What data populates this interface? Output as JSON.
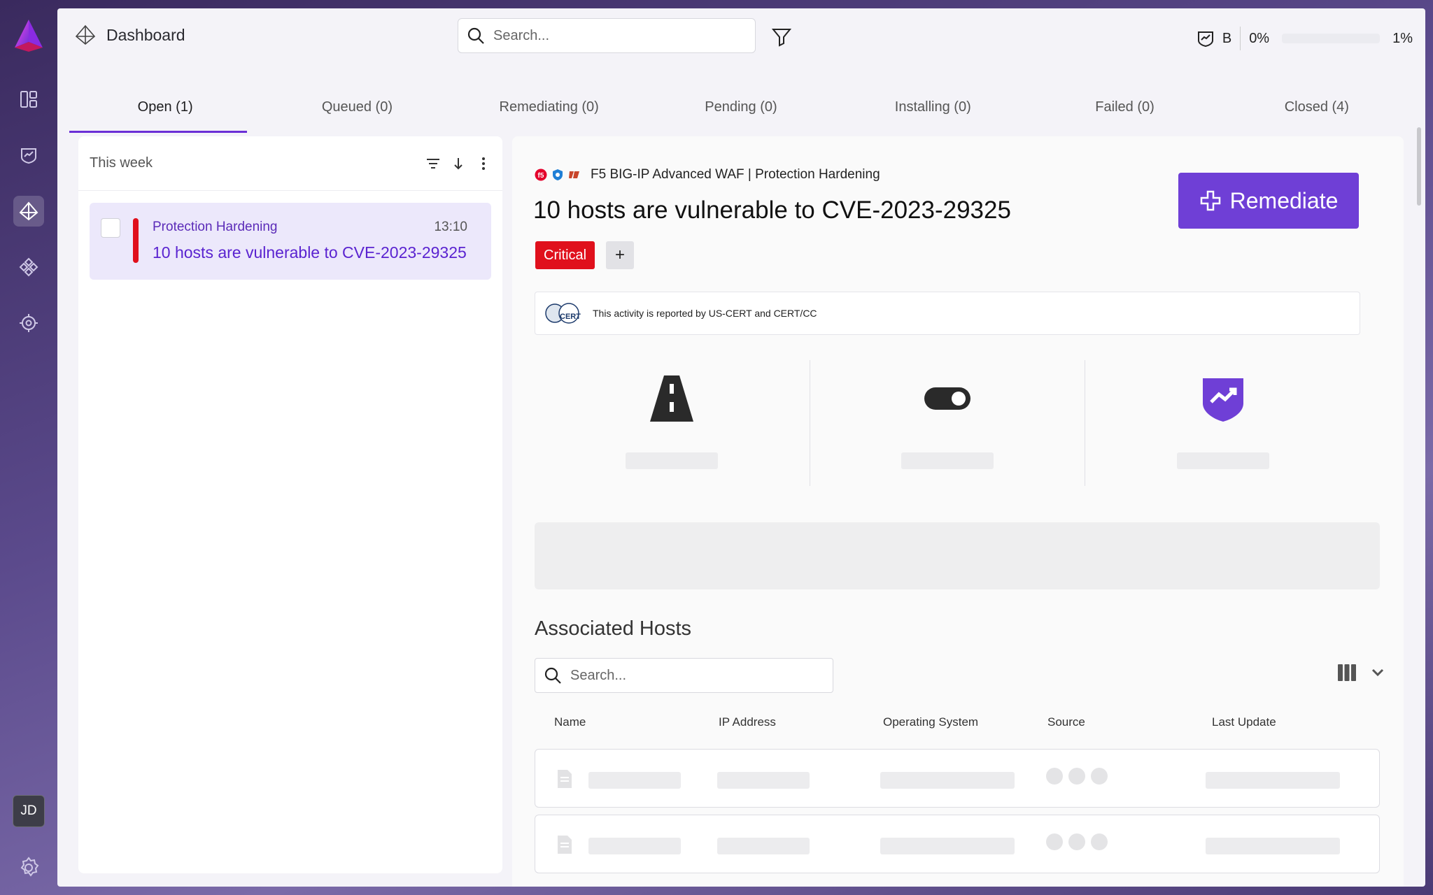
{
  "topbar": {
    "breadcrumb": "Dashboard",
    "search_placeholder": "Search...",
    "status_grade": "B",
    "status_percent_1": "0%",
    "status_percent_2": "1%"
  },
  "tabs": [
    {
      "label": "Open (1)",
      "active": true
    },
    {
      "label": "Queued (0)"
    },
    {
      "label": "Remediating (0)"
    },
    {
      "label": "Pending (0)"
    },
    {
      "label": "Installing (0)"
    },
    {
      "label": "Failed (0)"
    },
    {
      "label": "Closed (4)"
    }
  ],
  "list": {
    "header": "This week",
    "items": [
      {
        "category": "Protection Hardening",
        "time": "13:10",
        "title": "10 hosts are vulnerable to CVE-2023-29325",
        "severity_color": "#e0101c"
      }
    ]
  },
  "detail": {
    "vendor_line": "F5 BIG-IP Advanced WAF | Protection Hardening",
    "title": "10 hosts are vulnerable to CVE-2023-29325",
    "severity": "Critical",
    "add_tag": "+",
    "remediate_label": "Remediate",
    "cert_message": "This activity is reported by US-CERT and CERT/CC",
    "cert_logo_text": "CERT",
    "metrics_icons": [
      "road-icon",
      "toggle-icon",
      "shield-trend-icon"
    ],
    "hosts_section_title": "Associated Hosts",
    "hosts_search_placeholder": "Search...",
    "columns": [
      "Name",
      "IP Address",
      "Operating System",
      "Source",
      "Last Update"
    ]
  },
  "user": {
    "initials": "JD"
  },
  "colors": {
    "accent": "#6f3fd6",
    "critical": "#e0101c",
    "link": "#5a23d0"
  }
}
